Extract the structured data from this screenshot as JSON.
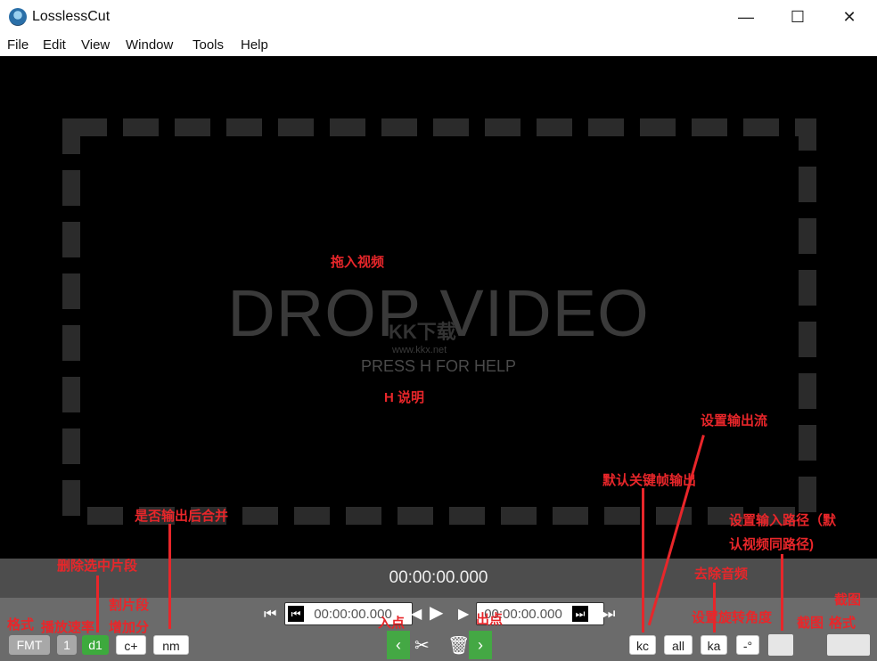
{
  "window": {
    "title": "LosslessCut",
    "minimize_glyph": "—",
    "maximize_glyph": "☐",
    "close_glyph": "✕"
  },
  "menu": {
    "items": [
      "File",
      "Edit",
      "View",
      "Window",
      "Tools",
      "Help"
    ]
  },
  "stage": {
    "drop_title": "DROP VIDEO",
    "help_hint": "PRESS H FOR HELP",
    "watermark": "KK下载",
    "watermark_url": "www.kkx.net"
  },
  "timeline": {
    "current_time": "00:00:00.000"
  },
  "controls": {
    "in_point": "00:00:00.000",
    "out_point": "00:00:00.000",
    "format": "FMT",
    "playback_rate": "1",
    "delete_segment": "d1",
    "add_segment": "c+",
    "merge": "nm",
    "keyframe_cut": "kc",
    "streams": "all",
    "keep_audio": "ka",
    "rotation": "-°"
  },
  "annotations": {
    "drag_video": "拖入视频",
    "h_help": "H 说明",
    "set_output_streams": "设置输出流",
    "default_keyframe_output": "默认关键帧输出",
    "merge_after_output": "是否输出后合并",
    "set_input_path": "设置输入路径（默认视频同路径)",
    "set_input_path_l1": "设置输入路径（默",
    "set_input_path_l2": "认视频同路径)",
    "delete_selected_segment": "删除选中片段",
    "add_split_segment_l1": "增加分",
    "add_split_segment_l2": "割片段",
    "remove_audio": "去除音频",
    "format": "格式",
    "playback_speed": "播放速率",
    "in_point": "入点",
    "out_point": "出点",
    "set_rotation": "设置旋转角度",
    "screenshot": "截图",
    "screenshot_label": "截图",
    "format_right": "格式"
  },
  "colors": {
    "annotation": "#e8262a",
    "accent_green": "#44a844"
  }
}
